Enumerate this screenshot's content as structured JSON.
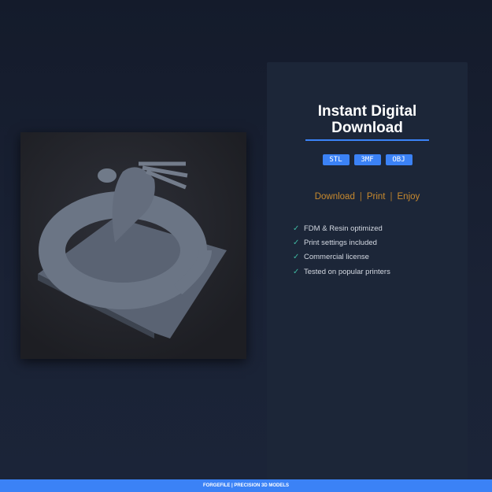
{
  "product_image": {
    "alt": "Coiled dragon 3D print model on square base"
  },
  "panel": {
    "title_line1": "Instant Digital",
    "title_line2": "Download",
    "formats": [
      "STL",
      "3MF",
      "OBJ"
    ],
    "tagline": [
      "Download",
      "Print",
      "Enjoy"
    ],
    "tagline_separator": "|",
    "features": [
      "FDM & Resin optimized",
      "Print settings included",
      "Commercial license",
      "Tested on popular printers"
    ],
    "check_glyph": "✓"
  },
  "footer": {
    "text": "FORGEFILE | PRECISION 3D MODELS"
  },
  "colors": {
    "accent": "#3b82f6",
    "tagline": "#c98a2e",
    "check": "#3fb7a0"
  }
}
